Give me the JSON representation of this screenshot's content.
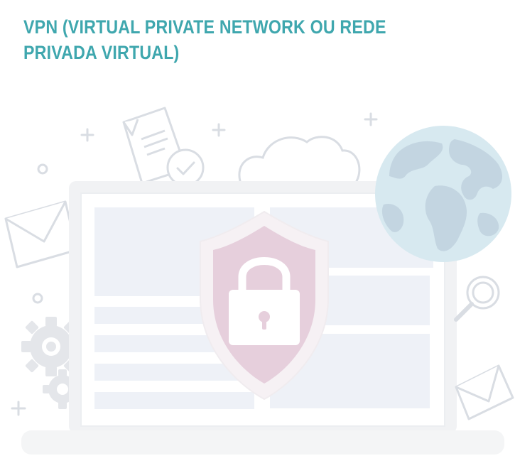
{
  "header": {
    "title": "VPN (VIRTUAL PRIVATE NETWORK OU REDE PRIVADA VIRTUAL)"
  },
  "colors": {
    "title": "#3fa7ae",
    "line_art": "#d9dde3",
    "shield_outer": "#f6f1f4",
    "shield_inner": "#e6cfdc",
    "screen_panel": "#eef1f7",
    "globe_ocean": "#d7e9f0",
    "globe_land": "#c3d5e1"
  },
  "icons": {
    "lock": "lock-icon",
    "shield": "shield-icon",
    "globe": "globe-icon",
    "cloud": "cloud-icon",
    "document": "document-icon",
    "envelope": "envelope-icon",
    "magnifier": "magnifier-icon",
    "gear": "gear-icon"
  }
}
